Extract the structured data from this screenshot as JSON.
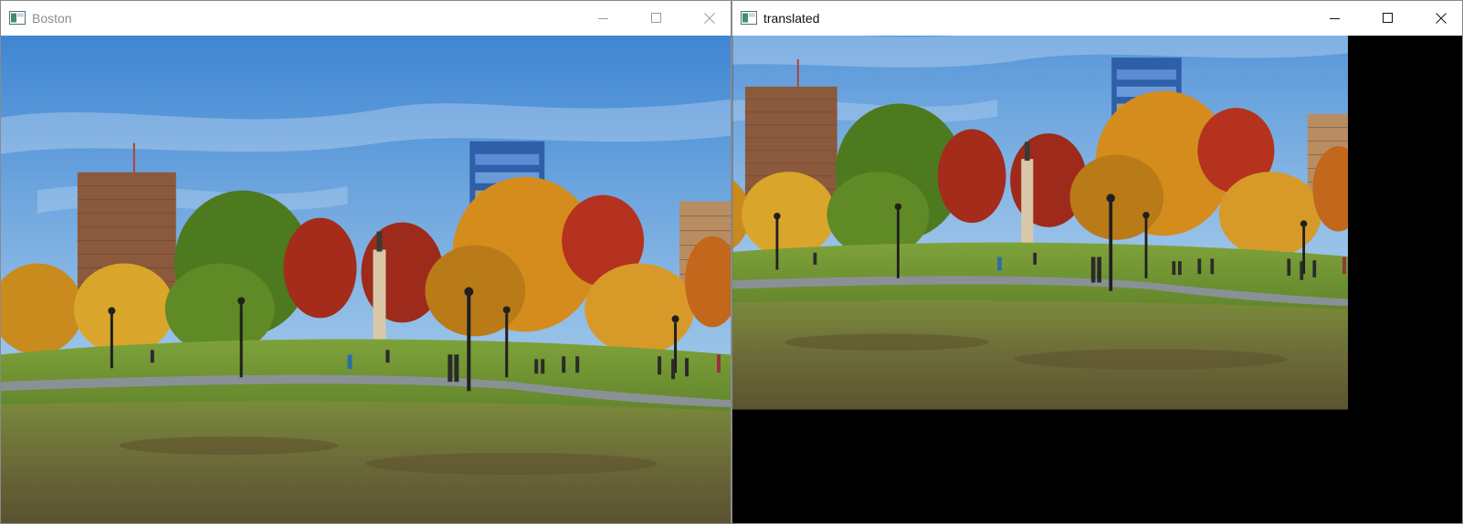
{
  "windows": [
    {
      "title": "Boston",
      "active": false,
      "controls": {
        "minimize": "minimize-icon",
        "maximize": "maximize-icon",
        "close": "close-icon"
      }
    },
    {
      "title": "translated",
      "active": true,
      "controls": {
        "minimize": "minimize-icon",
        "maximize": "maximize-icon",
        "close": "close-icon"
      }
    }
  ],
  "colors": {
    "sky_top": "#3f86d3",
    "sky_bottom": "#bcd7ee",
    "grass": "#6f8b34",
    "lawn": "#6a6a36",
    "path": "#8a9196",
    "foliage_orange": "#d48c1c",
    "foliage_green": "#4d7a1e",
    "foliage_red": "#a52b1a",
    "building_brown": "#8b5a3c",
    "building_glass": "#2f5fa8",
    "inactive_title": "#8c8c8c",
    "active_title": "#111111",
    "empty_region": "#000000"
  }
}
